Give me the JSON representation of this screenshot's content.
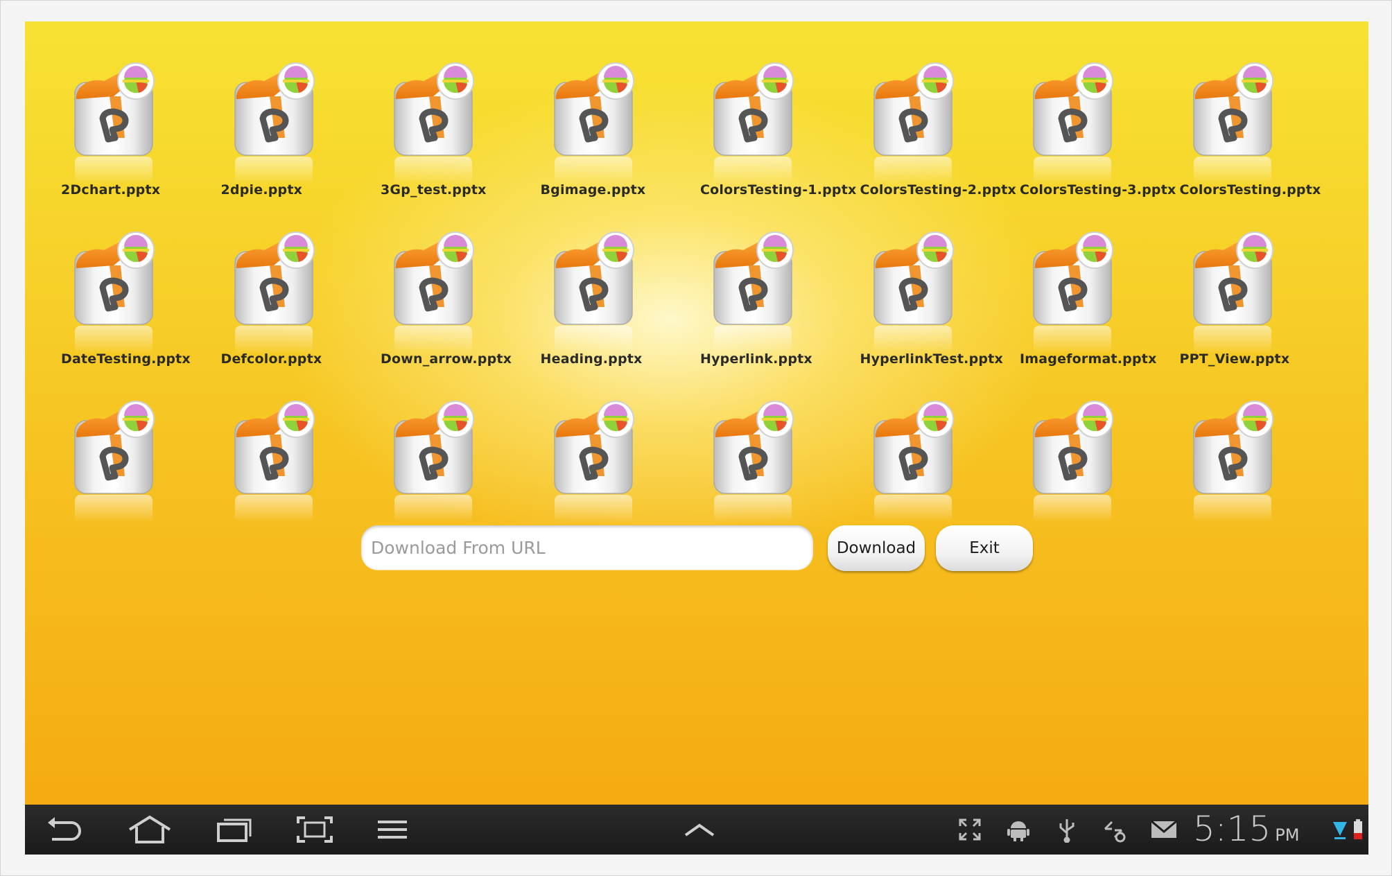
{
  "files": [
    {
      "name": "2Dchart.pptx"
    },
    {
      "name": "2dpie.pptx"
    },
    {
      "name": "3Gp_test.pptx"
    },
    {
      "name": "Bgimage.pptx"
    },
    {
      "name": "ColorsTesting-1.pptx"
    },
    {
      "name": "ColorsTesting-2.pptx"
    },
    {
      "name": "ColorsTesting-3.pptx"
    },
    {
      "name": "ColorsTesting.pptx"
    },
    {
      "name": "DateTesting.pptx"
    },
    {
      "name": "Defcolor.pptx"
    },
    {
      "name": "Down_arrow.pptx"
    },
    {
      "name": "Heading.pptx"
    },
    {
      "name": "Hyperlink.pptx"
    },
    {
      "name": "HyperlinkTest.pptx"
    },
    {
      "name": "Imageformat.pptx"
    },
    {
      "name": "PPT_View.pptx"
    },
    {
      "name": ""
    },
    {
      "name": ""
    },
    {
      "name": ""
    },
    {
      "name": ""
    },
    {
      "name": ""
    },
    {
      "name": ""
    },
    {
      "name": ""
    },
    {
      "name": ""
    }
  ],
  "url_bar": {
    "placeholder": "Download From URL",
    "value": ""
  },
  "buttons": {
    "download": "Download",
    "exit": "Exit"
  },
  "status_bar": {
    "time": "5:15",
    "ampm": "PM"
  },
  "icons": {
    "file": "pptx-file-icon",
    "nav": [
      "back-icon",
      "home-icon",
      "recent-apps-icon",
      "screenshot-icon",
      "menu-icon",
      "up-chevron-icon"
    ],
    "status": [
      "fullscreen-icon",
      "android-debug-icon",
      "usb-icon",
      "sync-icon",
      "email-icon",
      "wifi-icon",
      "battery-icon"
    ]
  },
  "colors": {
    "background_top": "#f7e233",
    "background_bottom": "#f5ab12",
    "icon_orange": "#f28a1a",
    "navbar": "#1e1e1e",
    "label_text": "#2a2a2a"
  }
}
